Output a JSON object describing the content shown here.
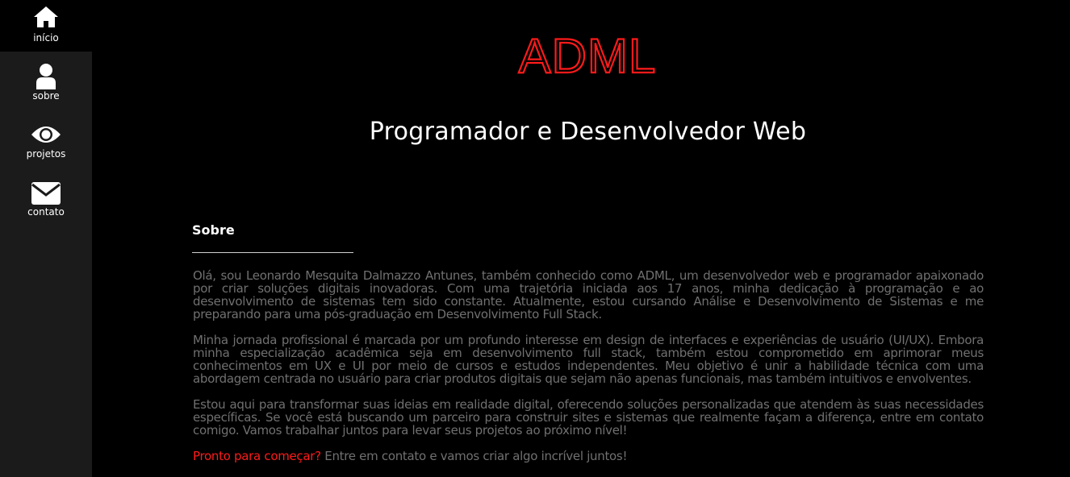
{
  "nav": {
    "items": [
      {
        "label": "início",
        "icon": "home-icon",
        "active": true
      },
      {
        "label": "sobre",
        "icon": "user-icon",
        "active": false
      },
      {
        "label": "projetos",
        "icon": "eye-icon",
        "active": false
      },
      {
        "label": "contato",
        "icon": "mail-icon",
        "active": false
      }
    ]
  },
  "header": {
    "logo_text": "ADML",
    "tagline": "Programador e Desenvolvedor Web"
  },
  "about": {
    "title": "Sobre",
    "paragraphs": [
      "Olá, sou Leonardo Mesquita Dalmazzo Antunes, também conhecido como ADML, um desenvolvedor web e programador apaixonado por criar soluções digitais inovadoras. Com uma trajetória iniciada aos 17 anos, minha dedicação à programação e ao desenvolvimento de sistemas tem sido constante. Atualmente, estou cursando Análise e Desenvolvimento de Sistemas e me preparando para uma pós-graduação em Desenvolvimento Full Stack.",
      "Minha jornada profissional é marcada por um profundo interesse em design de interfaces e experiências de usuário (UI/UX). Embora minha especialização acadêmica seja em desenvolvimento full stack, também estou comprometido em aprimorar meus conhecimentos em UX e UI por meio de cursos e estudos independentes. Meu objetivo é unir a habilidade técnica com uma abordagem centrada no usuário para criar produtos digitais que sejam não apenas funcionais, mas também intuitivos e envolventes.",
      "Estou aqui para transformar suas ideias em realidade digital, oferecendo soluções personalizadas que atendem às suas necessidades específicas. Se você está buscando um parceiro para construir sites e sistemas que realmente façam a diferença, entre em contato comigo. Vamos trabalhar juntos para levar seus projetos ao próximo nível!"
    ],
    "cta_highlight": "Pronto para começar?",
    "cta_rest": " Entre em contato e vamos criar algo incrível juntos!"
  },
  "colors": {
    "accent": "#ff1a1a",
    "sidebar_bg": "#1b1b1b",
    "body_text": "#707070"
  }
}
